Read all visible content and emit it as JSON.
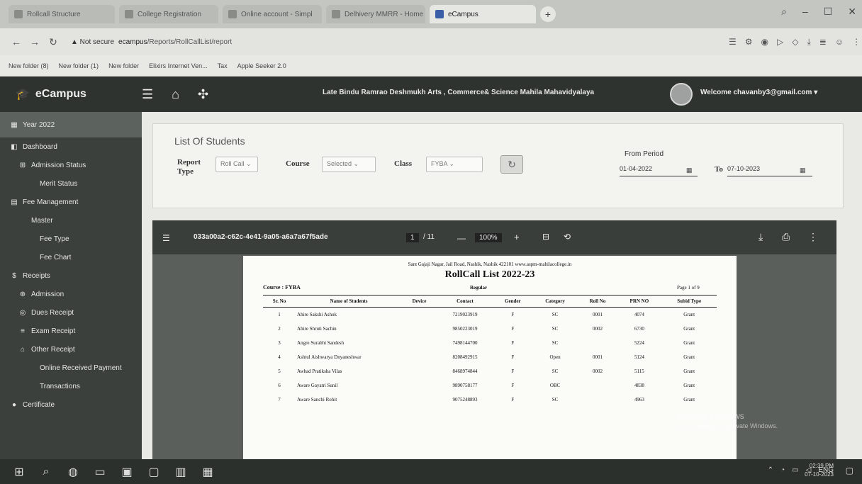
{
  "browser": {
    "tabs": [
      {
        "label": "Rollcall Structure"
      },
      {
        "label": "College Registration"
      },
      {
        "label": "Online account - Simpl"
      },
      {
        "label": "Delhivery MMRR - Home"
      },
      {
        "label": "eCampus"
      }
    ],
    "new_tab": "+",
    "url_warning": "▲ Not secure",
    "url_host": "ecampus",
    "url_path": "/Reports/RollCallList/report",
    "bookmarks": [
      "New folder (8)",
      "New folder (1)",
      "New folder",
      "Elixirs Internet Ven...",
      "Tax",
      "Apple Seeker 2.0"
    ]
  },
  "app": {
    "brand": "eCampus",
    "college": "Late Bindu Ramrao Deshmukh Arts , Commerce& Science Mahila Mahavidyalaya",
    "welcome": "Welcome chavanby3@gmail.com",
    "sidebar": {
      "year": "Year 2022",
      "items": [
        {
          "label": "Dashboard",
          "icon": "◧",
          "indent": 0
        },
        {
          "label": "Admission Status",
          "icon": "⊞",
          "indent": 1
        },
        {
          "label": "Merit Status",
          "icon": "",
          "indent": 2
        },
        {
          "label": "Fee Management",
          "icon": "▤",
          "indent": 0
        },
        {
          "label": "Master",
          "icon": "",
          "indent": 1
        },
        {
          "label": "Fee Type",
          "icon": "",
          "indent": 2
        },
        {
          "label": "Fee Chart",
          "icon": "",
          "indent": 2
        },
        {
          "label": "Receipts",
          "icon": "$",
          "indent": 0
        },
        {
          "label": "Admission",
          "icon": "⊕",
          "indent": 1
        },
        {
          "label": "Dues Receipt",
          "icon": "◎",
          "indent": 1
        },
        {
          "label": "Exam Receipt",
          "icon": "≡",
          "indent": 1
        },
        {
          "label": "Other Receipt",
          "icon": "⌂",
          "indent": 1
        },
        {
          "label": "Online Received Payment",
          "icon": "",
          "indent": 2
        },
        {
          "label": "Transactions",
          "icon": "",
          "indent": 2
        },
        {
          "label": "Certificate",
          "icon": "●",
          "indent": 0
        }
      ]
    },
    "panel": {
      "title": "List Of Students",
      "report_type_label": "Report Type",
      "report_type_value": "Roll Call",
      "course_label": "Course",
      "course_value": "Selected",
      "class_label": "Class",
      "class_value": "FYBA",
      "from_label": "From Period",
      "from_date": "01-04-2022",
      "to_label": "To",
      "to_date": "07-10-2023"
    }
  },
  "pdf": {
    "filename": "033a00a2-c62c-4e41-9a05-a6a7a67f5ade",
    "page": "1",
    "pages": "/ 11",
    "zoom": "100%",
    "doc_address": "Sant Gajaji Nagar, Jail Road, Nashik, Nashik 422101  www.aspm-mahilacollege.in",
    "doc_title": "RollCall List 2022-23",
    "course": "Course : FYBA",
    "regular": "Regular",
    "page_of": "Page 1 of 9",
    "columns": [
      "Sr. No",
      "Name of Students",
      "Device",
      "Contact",
      "Gender",
      "Category",
      "Roll No",
      "PRN NO",
      "Subid Type"
    ],
    "rows": [
      [
        "1",
        "Ahire Sakshi Ashok",
        "",
        "7219023919",
        "F",
        "SC",
        "0001",
        "4074",
        "Grant"
      ],
      [
        "2",
        "Ahire Shruti Sachin",
        "",
        "9850223019",
        "F",
        "SC",
        "0002",
        "6730",
        "Grant"
      ],
      [
        "3",
        "Angre Surabhi Sandesh",
        "",
        "7498144700",
        "F",
        "SC",
        "",
        "5224",
        "Grant"
      ],
      [
        "4",
        "Ashtul Aishwarya Dnyaneshwar",
        "",
        "8208492915",
        "F",
        "Open",
        "0001",
        "5124",
        "Grant"
      ],
      [
        "5",
        "Awhad Pratiksha Vilas",
        "",
        "8468974844",
        "F",
        "SC",
        "0002",
        "5115",
        "Grant"
      ],
      [
        "6",
        "Aware Gayatri Sunil",
        "",
        "9890758177",
        "F",
        "OBC",
        "",
        "4838",
        "Grant"
      ],
      [
        "7",
        "Aware Sanchi Rohit",
        "",
        "9075248893",
        "F",
        "SC",
        "",
        "4963",
        "Grant"
      ]
    ]
  },
  "os": {
    "watermark_line1": "Activate Windows",
    "watermark_line2": "Go to Settings to activate Windows.",
    "lang": "ENG",
    "time": "02:39 PM",
    "date": "07-10-2023"
  }
}
